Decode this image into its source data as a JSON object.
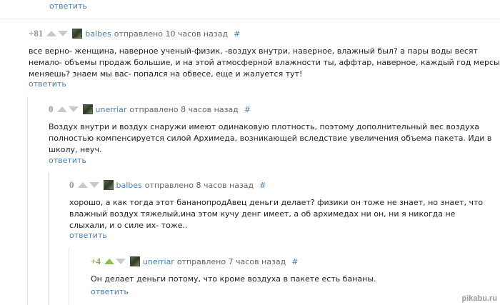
{
  "top_reply": "ответить",
  "comments": [
    {
      "rating": "+81",
      "username": "balbes",
      "meta": "отправлено 10 часов назад",
      "hash": "#",
      "lines": [
        "все верно- женщина, наверное ученый-физик, -воздух внутри, наверное, влажный был? а пары воды весят",
        "немало- объемы продаж большие, и на этой атмосферной влажности ты, аффтар, наверное, каждый год мерсы",
        "меняешь? знаем мы вас- попался на обвесе, еще и жалуется тут!"
      ],
      "reply": "ответить"
    },
    {
      "rating": "0",
      "username": "unerriar",
      "meta": "отправлено 8 часов назад",
      "hash": "#",
      "lines": [
        "Воздух внутри и воздух снаружи имеют одинаковую плотность, поэтому дополнительный вес воздуха",
        "полностью компенсируется силой Архимеда, возникающей вследствие увеличения объема пакета. Иди в",
        "школу, неуч."
      ],
      "reply": "ответить"
    },
    {
      "rating": "0",
      "username": "balbes",
      "meta": "отправлено 8 часов назад",
      "hash": "#",
      "lines": [
        "хорошо, а как тогда этот бананопродАвец деньги делает? физики он тоже не знает, но знает, что",
        "влажный воздух тяжелый,ина этом кучу денг имеет, а об архимедах ни он, ни я никогда не",
        "слыхали, и о силе их- тоже.."
      ],
      "reply": "ответить"
    },
    {
      "rating": "+4",
      "username": "unerriar",
      "meta": "отправлено 7 часов назад",
      "hash": "#",
      "lines": [
        "Он делает деньги потому, что кроме воздуха в пакете есть бананы."
      ],
      "reply": "ответить"
    }
  ],
  "watermark": "pikabu.ru",
  "colors": {
    "link": "#4a7fb0",
    "positive": "#7fa84a",
    "upvote_active": "#8fbf3f"
  }
}
